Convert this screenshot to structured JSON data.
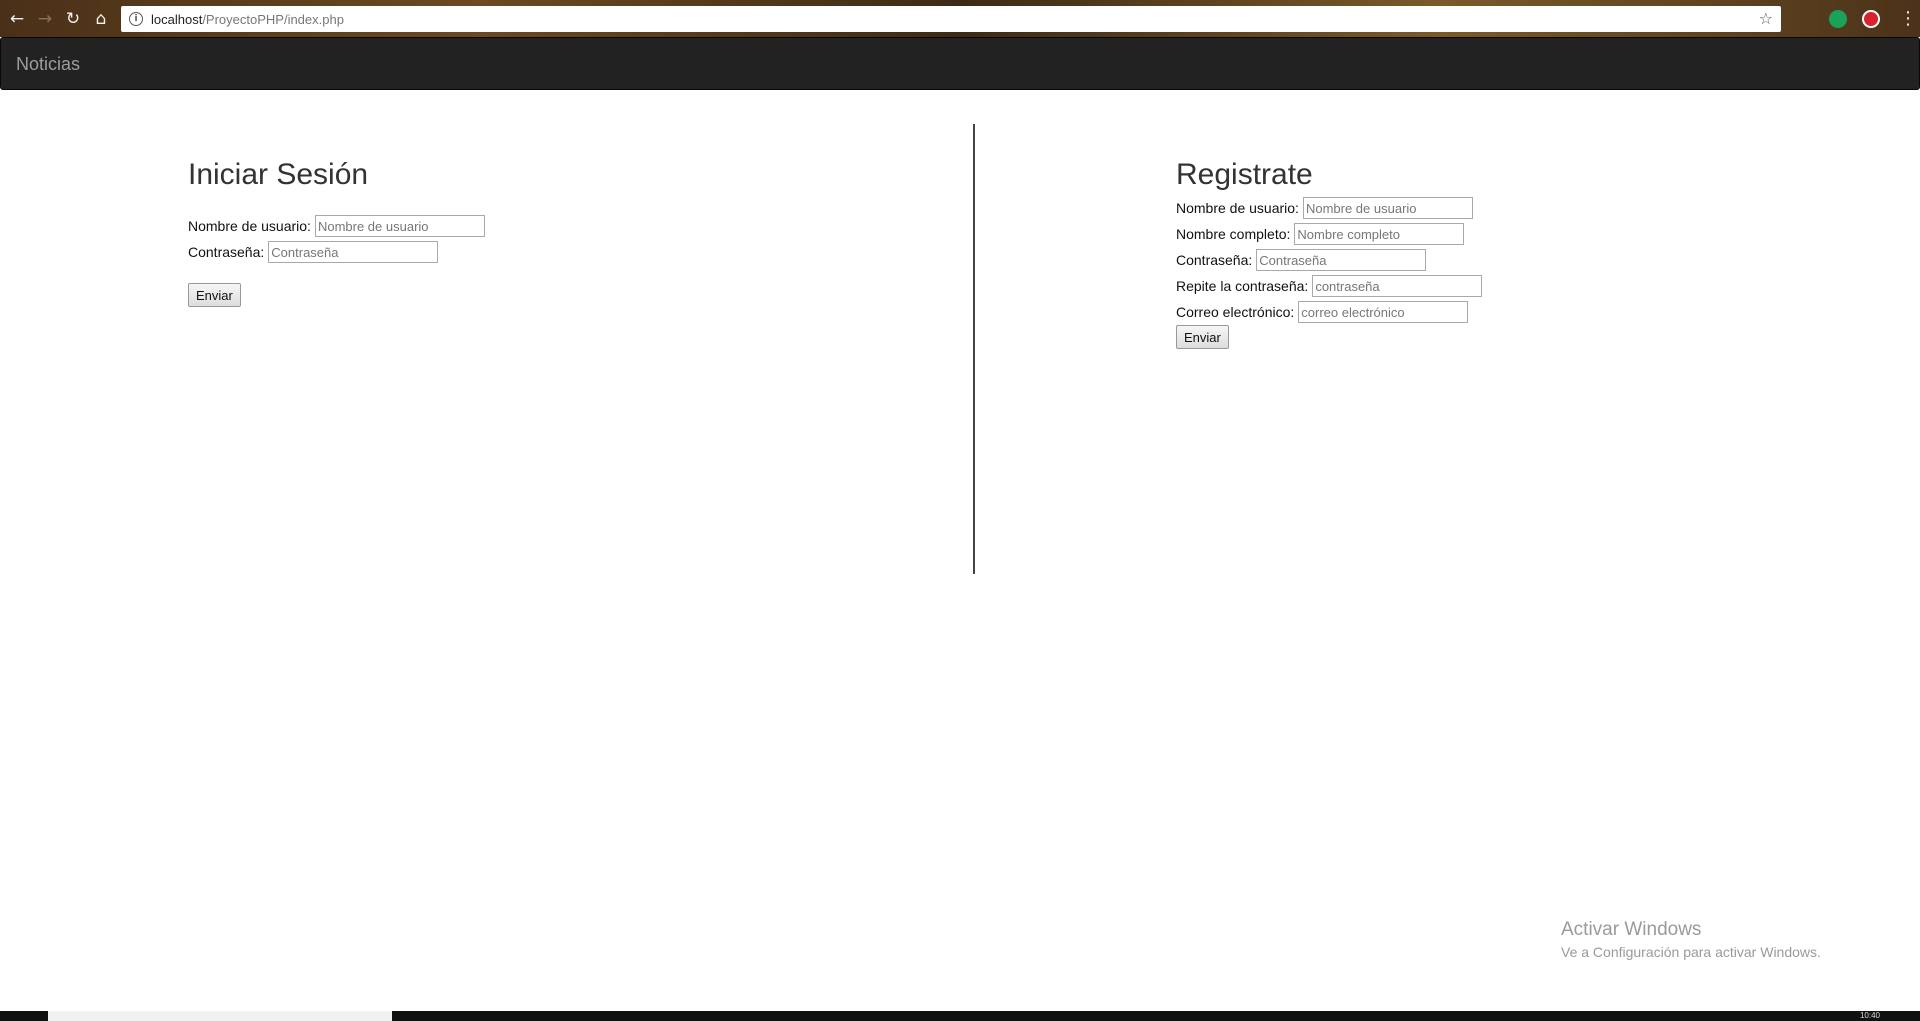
{
  "browser": {
    "url_host": "localhost",
    "url_path": "/ProyectoPHP/index.php",
    "icons": {
      "back": "←",
      "forward": "→",
      "reload": "↻",
      "home": "⌂",
      "info": "i",
      "star": "☆",
      "menu": "⋮"
    }
  },
  "navbar": {
    "brand": "Noticias"
  },
  "login": {
    "title": "Iniciar Sesión",
    "fields": [
      {
        "label": "Nombre de usuario:",
        "placeholder": "Nombre de usuario",
        "value": ""
      },
      {
        "label": "Contraseña:",
        "placeholder": "Contraseña",
        "value": ""
      }
    ],
    "submit": "Enviar"
  },
  "register": {
    "title": "Registrate",
    "fields": [
      {
        "label": "Nombre de usuario:",
        "placeholder": "Nombre de usuario",
        "value": ""
      },
      {
        "label": "Nombre completo:",
        "placeholder": "Nombre completo",
        "value": ""
      },
      {
        "label": "Contraseña:",
        "placeholder": "Contraseña",
        "value": ""
      },
      {
        "label": "Repite la contraseña:",
        "placeholder": "contraseña",
        "value": ""
      },
      {
        "label": "Correo electrónico:",
        "placeholder": "correo electrónico",
        "value": ""
      }
    ],
    "submit": "Enviar"
  },
  "watermark": {
    "title": "Activar Windows",
    "subtitle": "Ve a Configuración para activar Windows."
  },
  "taskbar": {
    "clock": "10:40"
  }
}
